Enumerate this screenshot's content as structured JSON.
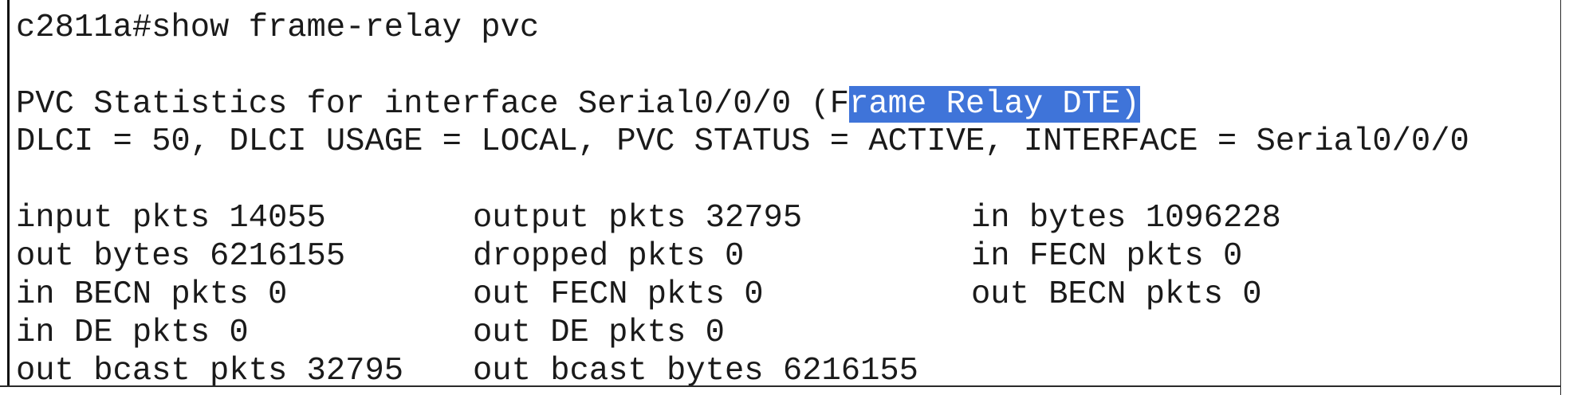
{
  "colors": {
    "background": "#ffffff",
    "text": "#1a1a1a",
    "selection_bg": "#3f74d9",
    "selection_text": "#ffffff"
  },
  "terminal": {
    "command_line": "c2811a#show frame-relay pvc",
    "header_prefix": "PVC Statistics for interface Serial0/0/0 (F",
    "header_selected": "rame Relay DTE)",
    "dlci_line": "DLCI = 50, DLCI USAGE = LOCAL, PVC STATUS = ACTIVE, INTERFACE = Serial0/0/0",
    "stats": [
      [
        "input pkts 14055",
        "output pkts 32795",
        "in bytes 1096228"
      ],
      [
        "out bytes 6216155",
        "dropped pkts 0",
        "in FECN pkts 0"
      ],
      [
        "in BECN pkts 0",
        "out FECN pkts 0",
        "out BECN pkts 0"
      ],
      [
        "in DE pkts 0",
        "out DE pkts 0",
        ""
      ],
      [
        "out bcast pkts 32795",
        "out bcast bytes 6216155",
        ""
      ]
    ]
  }
}
